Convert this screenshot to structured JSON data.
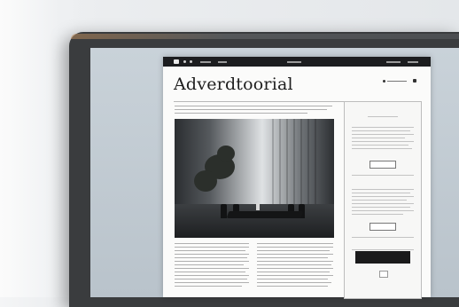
{
  "page": {
    "headline": "Adverdtoorial"
  },
  "sidebar": {
    "section1_heading": "",
    "section1_button": "",
    "section2_heading": "",
    "section2_button": "",
    "section3_heading": "",
    "subscribe_label": ""
  },
  "colors": {
    "nav_background": "#1c1d1f",
    "page_background": "#fbfbfa",
    "headline": "#1e1e1e",
    "monitor_bezel": "#3a3c3e"
  },
  "icons": [
    "logo-icon",
    "user-icon",
    "bag-icon"
  ]
}
